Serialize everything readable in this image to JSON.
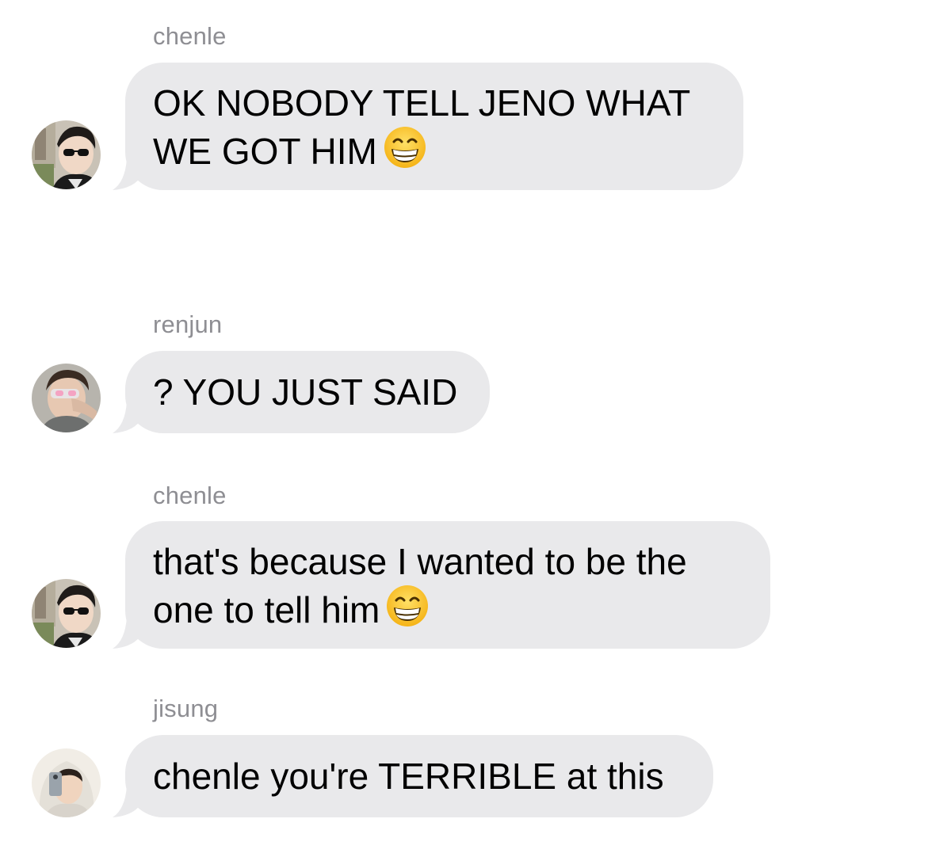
{
  "messages": [
    {
      "sender": "chenle",
      "lines": [
        "OK NOBODY TELL JENO WHAT",
        "WE GOT HIM"
      ],
      "emoji": "grinning-face-with-smiling-eyes",
      "avatar": "chenle-avatar"
    },
    {
      "sender": "renjun",
      "lines": [
        "? YOU JUST SAID"
      ],
      "avatar": "renjun-avatar"
    },
    {
      "sender": "chenle",
      "lines": [
        "that's because I wanted to be the",
        "one to tell him"
      ],
      "emoji": "grinning-face-with-smiling-eyes",
      "avatar": "chenle-avatar"
    },
    {
      "sender": "jisung",
      "lines": [
        "chenle you're TERRIBLE at this"
      ],
      "avatar": "jisung-avatar"
    }
  ],
  "colors": {
    "bubble": "#e9e9eb",
    "sender_text": "#8e8e93",
    "message_text": "#000000",
    "background": "#ffffff"
  }
}
